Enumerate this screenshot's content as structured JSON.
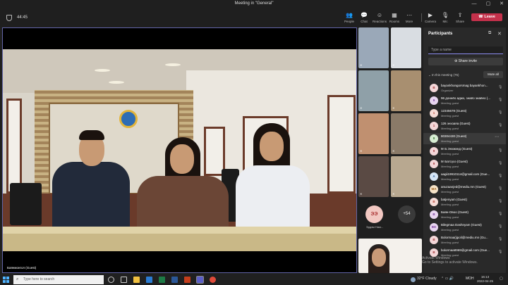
{
  "window": {
    "title": "Meeting in \"General\"",
    "minimize": "—",
    "maximize": "▢",
    "close": "✕"
  },
  "toolbar": {
    "timer": "44:45",
    "buttons": [
      {
        "label": "People",
        "icon": "people-icon",
        "glyph": "👥"
      },
      {
        "label": "Chat",
        "icon": "chat-icon",
        "glyph": "💬"
      },
      {
        "label": "Reactions",
        "icon": "reactions-icon",
        "glyph": "☺"
      },
      {
        "label": "Rooms",
        "icon": "rooms-icon",
        "glyph": "▦"
      },
      {
        "label": "More",
        "icon": "more-icon",
        "glyph": "⋯"
      },
      {
        "label": "Camera",
        "icon": "camera-icon",
        "glyph": "▶"
      },
      {
        "label": "Mic",
        "icon": "mic-icon",
        "glyph": "🎙"
      },
      {
        "label": "Share",
        "icon": "share-icon",
        "glyph": "⇪"
      }
    ],
    "leave_label": "Leave",
    "accent": "#8b8cf0",
    "leave_color": "#c4314b"
  },
  "main_video": {
    "name_tag": "Баянмонгол (Guest)"
  },
  "grid": {
    "avatar_initials": "ЭЭ",
    "avatar_name": "Эрдэм Нам...",
    "more_count": "+54"
  },
  "panel": {
    "title": "Participants",
    "search_placeholder": "Type a name",
    "share_invite": "Share invite",
    "in_meeting": "In this meeting (75)",
    "mute_all": "Mute all",
    "participants": [
      {
        "initials": "B",
        "name": "bayankhongorsmag bayankhon...",
        "role": "Organizer",
        "bg": "#f3d6d8",
        "fg": "#a4373a"
      },
      {
        "initials": "9",
        "name": "96 доннёо адмэ, знаёо знаёео (...",
        "role": "Meeting guest",
        "bg": "#e8d5f0",
        "fg": "#7a3e9d"
      },
      {
        "initials": "1",
        "name": "12345678 (Guest)",
        "role": "Meeting guest",
        "bg": "#f6dcd7",
        "fg": "#b94a3b"
      },
      {
        "initials": "1",
        "name": "126 энхзаяа (Guest)",
        "role": "Meeting guest",
        "bg": "#f3d6d8",
        "fg": "#a4373a"
      },
      {
        "initials": "8",
        "name": "80304430 (Guest)",
        "role": "Meeting guest",
        "bg": "#d6ecd2",
        "fg": "#3d7a35"
      },
      {
        "initials": "9",
        "name": "9r Б.Энхжинд (Guest)",
        "role": "Meeting guest",
        "bg": "#f3d6d8",
        "fg": "#a4373a"
      },
      {
        "initials": "9",
        "name": "9r Батсүхэ (Guest)",
        "role": "Meeting guest",
        "bg": "#f3d6d8",
        "fg": "#a4373a"
      },
      {
        "initials": "A",
        "name": "aagii19910114@gmail.com (Gue...",
        "role": "Meeting guest",
        "bg": "#d6e6f6",
        "fg": "#2f5f9a"
      },
      {
        "initials": "MA",
        "name": "anuzaanjed@mediu.mn (Guest)",
        "role": "Meeting guest",
        "bg": "#f6e3c8",
        "fg": "#9a5c17"
      },
      {
        "initials": "B",
        "name": "batjenyam (Guest)",
        "role": "Meeting guest",
        "bg": "#f6dcd7",
        "fg": "#b94a3b"
      },
      {
        "initials": "B",
        "name": "Баян-Овоо (Guest)",
        "role": "Meeting guest",
        "bg": "#e8d5f0",
        "fg": "#7a3e9d"
      },
      {
        "initials": "BD",
        "name": "Bilegmaa Dashnyam (Guest)",
        "role": "Meeting guest",
        "bg": "#e8d5f0",
        "fg": "#7a3e9d"
      },
      {
        "initials": "B",
        "name": "Bolormaa(ijpoli@mediu.mn (Gu...",
        "role": "Meeting guest",
        "bg": "#f3d6d8",
        "fg": "#a4373a"
      },
      {
        "initials": "B",
        "name": "bolormaa8969@gmail.com (Gue...",
        "role": "Meeting guest",
        "bg": "#f3d6d8",
        "fg": "#a4373a"
      }
    ]
  },
  "watermark": {
    "line1": "Activate Windows",
    "line2": "Go to Settings to activate Windows."
  },
  "taskbar": {
    "search_placeholder": "Type here to search",
    "weather": "32°F Cloudy",
    "lang": "МОН",
    "time": "16:13",
    "date": "2022-04-25"
  }
}
